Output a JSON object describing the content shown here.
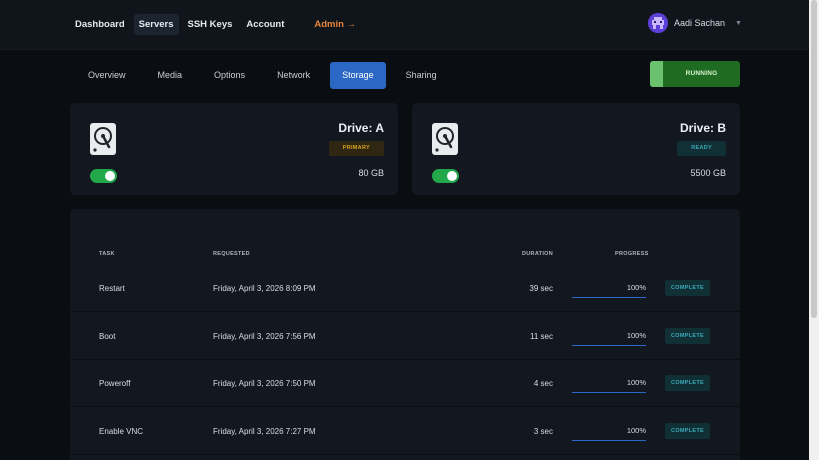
{
  "topnav": {
    "items": [
      {
        "label": "Dashboard"
      },
      {
        "label": "Servers"
      },
      {
        "label": "SSH Keys"
      },
      {
        "label": "Account"
      }
    ],
    "admin_label": "Admin →"
  },
  "user": {
    "name": "Aadi Sachan",
    "caret": "▼"
  },
  "tabs": [
    {
      "label": "Overview"
    },
    {
      "label": "Media"
    },
    {
      "label": "Options"
    },
    {
      "label": "Network"
    },
    {
      "label": "Storage"
    },
    {
      "label": "Sharing"
    }
  ],
  "active_tab": "Storage",
  "status": {
    "label": "RUNNING",
    "color": "#1f6b22"
  },
  "drives": [
    {
      "name": "Drive: A",
      "badge": "PRIMARY",
      "size": "80 GB",
      "enabled": true
    },
    {
      "name": "Drive: B",
      "badge": "READY",
      "size": "5500 GB",
      "enabled": true
    }
  ],
  "tasks": {
    "headers": {
      "task": "TASK",
      "requested": "REQUESTED",
      "duration": "DURATION",
      "progress": "PROGRESS"
    },
    "rows": [
      {
        "task": "Restart",
        "requested": "Friday, April 3, 2026 8:09 PM",
        "duration": "39 sec",
        "progress": "100%",
        "status": "COMPLETE"
      },
      {
        "task": "Boot",
        "requested": "Friday, April 3, 2026 7:56 PM",
        "duration": "11 sec",
        "progress": "100%",
        "status": "COMPLETE"
      },
      {
        "task": "Poweroff",
        "requested": "Friday, April 3, 2026 7:50 PM",
        "duration": "4 sec",
        "progress": "100%",
        "status": "COMPLETE"
      },
      {
        "task": "Enable VNC",
        "requested": "Friday, April 3, 2026 7:27 PM",
        "duration": "3 sec",
        "progress": "100%",
        "status": "COMPLETE"
      }
    ]
  },
  "colors": {
    "accent": "#2b67c4",
    "admin": "#e8833a",
    "toggle_on": "#22a84a"
  }
}
